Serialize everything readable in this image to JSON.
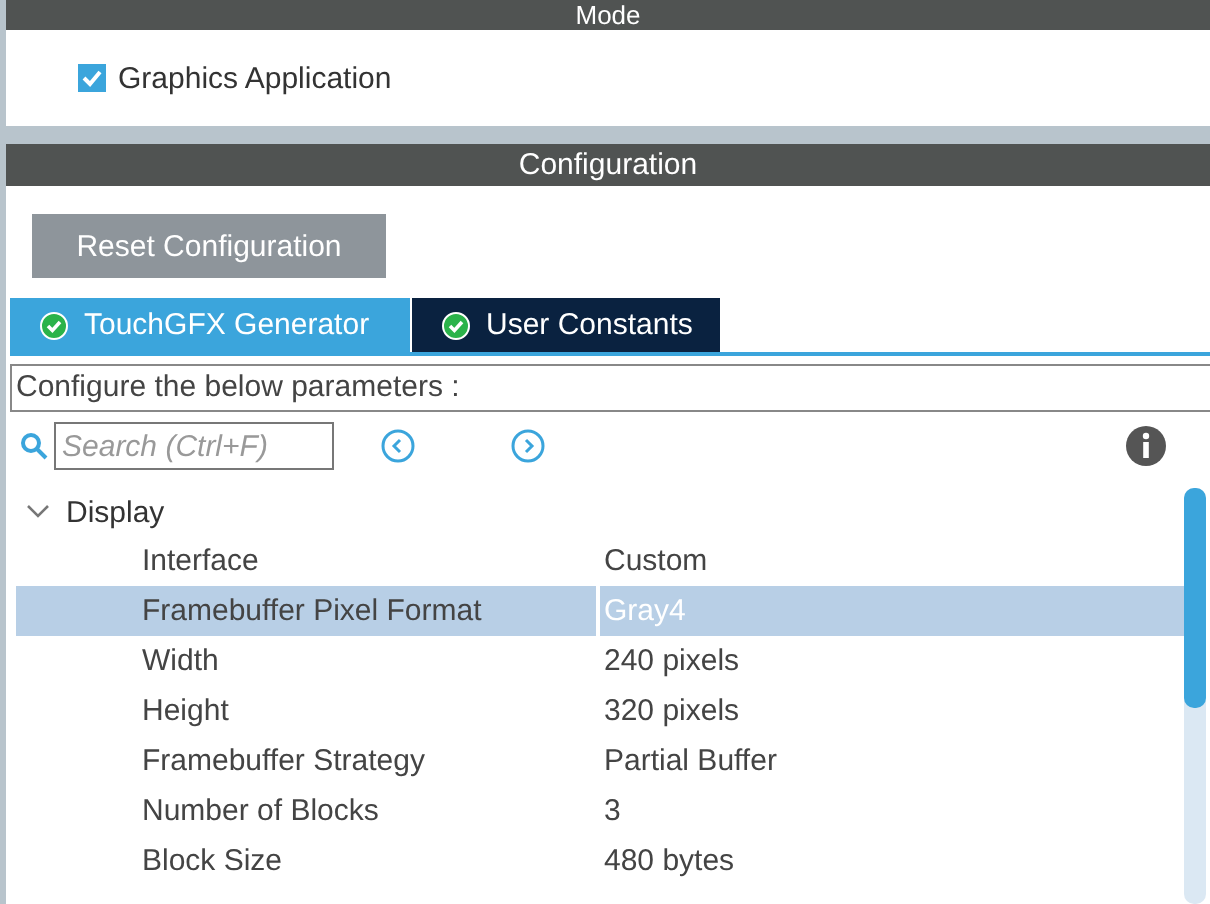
{
  "mode": {
    "title": "Mode",
    "checkbox": {
      "label": "Graphics Application",
      "checked": true
    }
  },
  "configuration": {
    "title": "Configuration",
    "reset_button": "Reset Configuration",
    "tabs": [
      {
        "label": "TouchGFX Generator",
        "selected": true
      },
      {
        "label": "User Constants",
        "selected": false
      }
    ],
    "hint": "Configure the below parameters :",
    "search": {
      "placeholder": "Search (Ctrl+F)"
    },
    "tree": [
      {
        "label": "Display",
        "expanded": true,
        "children": [
          {
            "name": "Interface",
            "value": "Custom",
            "selected": false
          },
          {
            "name": "Framebuffer Pixel Format",
            "value": "Gray4",
            "selected": true
          },
          {
            "name": "Width",
            "value": "240 pixels",
            "selected": false
          },
          {
            "name": "Height",
            "value": "320 pixels",
            "selected": false
          },
          {
            "name": "Framebuffer Strategy",
            "value": "Partial Buffer",
            "selected": false
          },
          {
            "name": "Number of Blocks",
            "value": "3",
            "selected": false
          },
          {
            "name": "Block Size",
            "value": "480 bytes",
            "selected": false
          }
        ]
      }
    ]
  }
}
